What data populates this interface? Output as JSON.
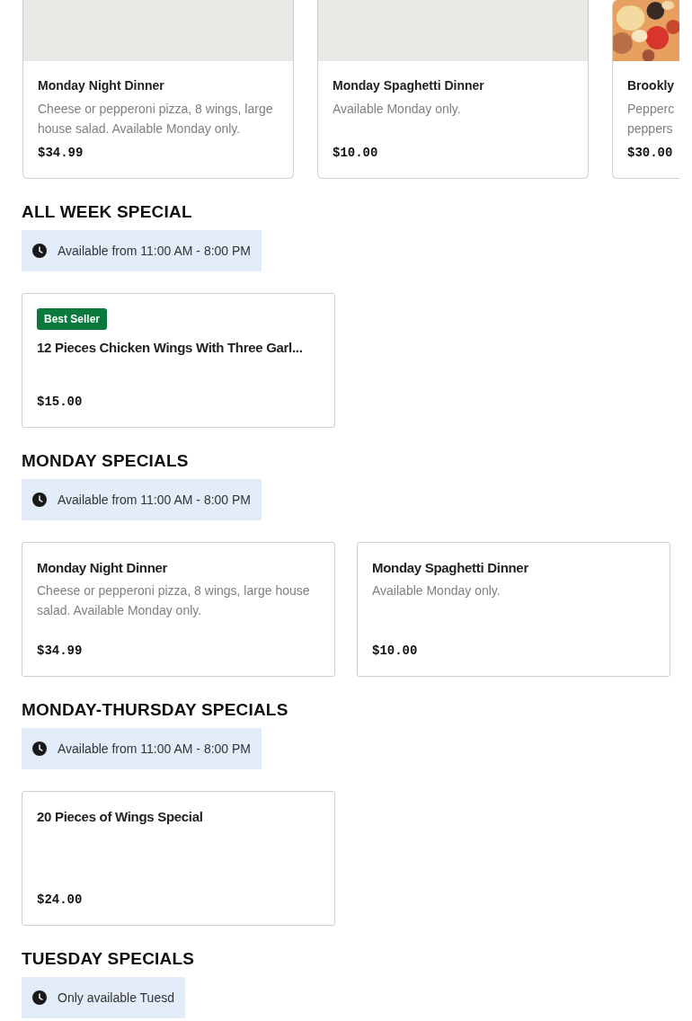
{
  "carousel": [
    {
      "kind": "blank",
      "title": "Monday Night Dinner",
      "description": "Cheese or pepperoni pizza, 8 wings, large house salad. Available Monday only.",
      "price": "$34.99"
    },
    {
      "kind": "blank",
      "title": "Monday Spaghetti Dinner",
      "description": "Available Monday only.",
      "price": "$10.00"
    },
    {
      "kind": "picture",
      "title": "Brookly",
      "description": "Pepperc peppers",
      "price": "$30.00"
    }
  ],
  "sections": [
    {
      "title": "ALL WEEK SPECIAL",
      "availability": "Available from 11:00 AM - 8:00 PM",
      "items": [
        {
          "badge": "Best Seller",
          "title": "12 Pieces Chicken Wings With Three Garl...",
          "price": "$15.00"
        }
      ]
    },
    {
      "title": "MONDAY SPECIALS",
      "availability": "Available from 11:00 AM - 8:00 PM",
      "items": [
        {
          "title": "Monday Night Dinner",
          "description": "Cheese or pepperoni pizza, 8 wings, large house salad. Available Monday only.",
          "price": "$34.99"
        },
        {
          "title": "Monday Spaghetti Dinner",
          "description": "Available Monday only.",
          "price": "$10.00"
        }
      ]
    },
    {
      "title": "MONDAY-THURSDAY SPECIALS",
      "availability": "Available from 11:00 AM - 8:00 PM",
      "items": [
        {
          "title": "20 Pieces of Wings Special",
          "price": "$24.00"
        }
      ]
    },
    {
      "title": "TUESDAY SPECIALS",
      "availability": "Only available Tuesd"
    }
  ]
}
